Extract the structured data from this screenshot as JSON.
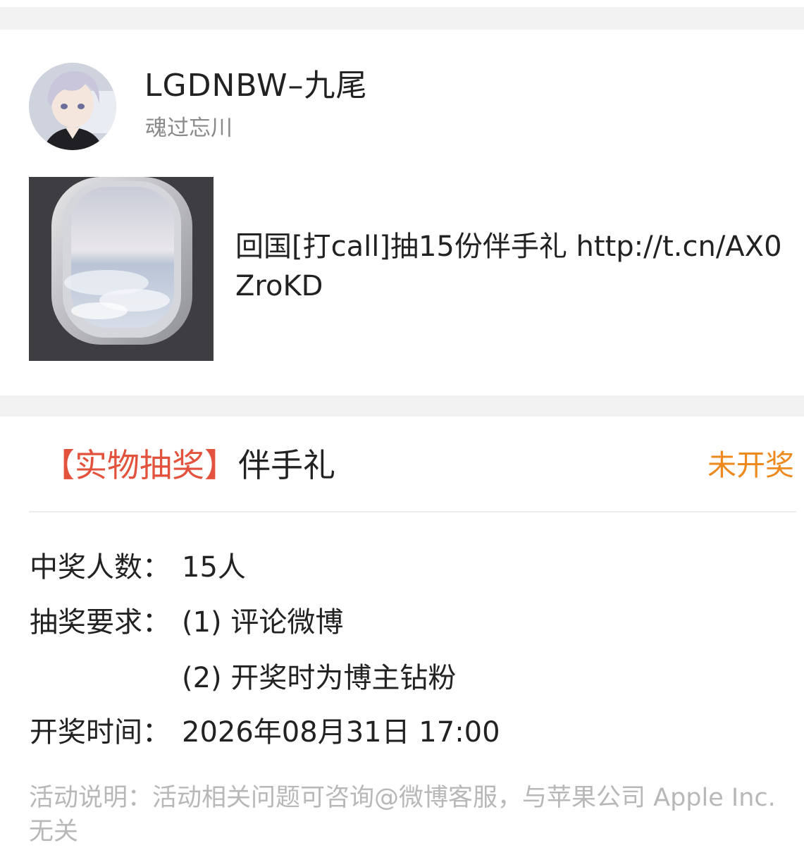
{
  "post": {
    "username": "LGDNBW–九尾",
    "subtitle": "魂过忘川",
    "text": "回国[打call]抽15份伴手礼  http://t.cn/AX0ZroKD"
  },
  "lottery": {
    "type_label": "【实物抽奖】",
    "prize": "伴手礼",
    "status": "未开奖",
    "winners_label": "中奖人数：",
    "winners_value": "15人",
    "requirements_label": "抽奖要求：",
    "requirements": [
      "(1) 评论微博",
      "(2) 开奖时为博主钻粉"
    ],
    "draw_time_label": "开奖时间：",
    "draw_time_value": "2026年08月31日 17:00",
    "note": "活动说明：活动相关问题可咨询@微博客服，与苹果公司 Apple Inc. 无关"
  },
  "colors": {
    "accent_red": "#e2523c",
    "status_orange": "#ee8a1d",
    "muted_gray": "#b8b8b8"
  }
}
